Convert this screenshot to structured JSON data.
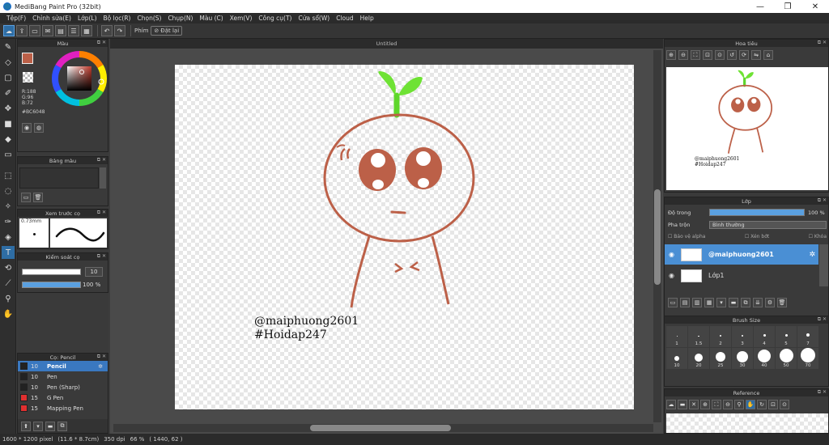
{
  "window": {
    "title": "MediBang Paint Pro (32bit)",
    "minimize": "—",
    "maximize": "❐",
    "close": "✕"
  },
  "menu": [
    "Tệp(F)",
    "Chỉnh sửa(E)",
    "Lớp(L)",
    "Bộ lọc(R)",
    "Chọn(S)",
    "Chụp(N)",
    "Màu (C)",
    "Xem(V)",
    "Công cụ(T)",
    "Cửa sổ(W)",
    "Cloud",
    "Help"
  ],
  "toolbar": {
    "shortcut_label": "Phím",
    "reset_label": "Đặt lại"
  },
  "color_panel": {
    "title": "Màu",
    "r": "R:188",
    "g": "G:96",
    "b": "B:72",
    "hex": "#BC6048",
    "main_color": "#bc6048"
  },
  "palette_panel": {
    "title": "Bảng màu"
  },
  "brush_preview_panel": {
    "title": "Xem trước cọ",
    "size": "0.73mm"
  },
  "brush_control_panel": {
    "title": "Kiểm soát cọ",
    "size_value": "10",
    "opacity_value": "100 %"
  },
  "brush_list_panel": {
    "title": "Cọ: Pencil",
    "items": [
      {
        "size": "10",
        "name": "Pencil",
        "color": "#222222",
        "selected": true
      },
      {
        "size": "10",
        "name": "Pen",
        "color": "#222222",
        "selected": false
      },
      {
        "size": "10",
        "name": "Pen (Sharp)",
        "color": "#222222",
        "selected": false
      },
      {
        "size": "15",
        "name": "G Pen",
        "color": "#e03030",
        "selected": false
      },
      {
        "size": "15",
        "name": "Mapping Pen",
        "color": "#e03030",
        "selected": false
      }
    ]
  },
  "document": {
    "tab": "Untitled"
  },
  "canvas_text": {
    "line1": "@maiphuong2601",
    "line2": "#Hoidap247"
  },
  "navigator_panel": {
    "title": "Hoa tiêu"
  },
  "layer_panel": {
    "title": "Lớp",
    "opacity_label": "Độ trong",
    "opacity_value": "100 %",
    "opacity_level": 1.0,
    "blend_label": "Pha trộn",
    "blend_value": "Bình thường",
    "protect_alpha": "Bảo vệ alpha",
    "clipping": "Xén bớt",
    "lock": "Khóa",
    "layers": [
      {
        "name": "@maiphuong2601",
        "selected": true
      },
      {
        "name": "Lớp1",
        "selected": false
      }
    ]
  },
  "brush_size_panel": {
    "title": "Brush Size",
    "row1": [
      "1",
      "1.5",
      "2",
      "3",
      "4",
      "5",
      "7"
    ],
    "row2": [
      "10",
      "20",
      "25",
      "30",
      "40",
      "50",
      "70"
    ]
  },
  "reference_panel": {
    "title": "Reference"
  },
  "status": {
    "size": "1600 * 1200 pixel",
    "physical": "(11.6 * 8.7cm)",
    "dpi": "350 dpi",
    "zoom": "66 %",
    "coords": "( 1440, 62 )"
  }
}
